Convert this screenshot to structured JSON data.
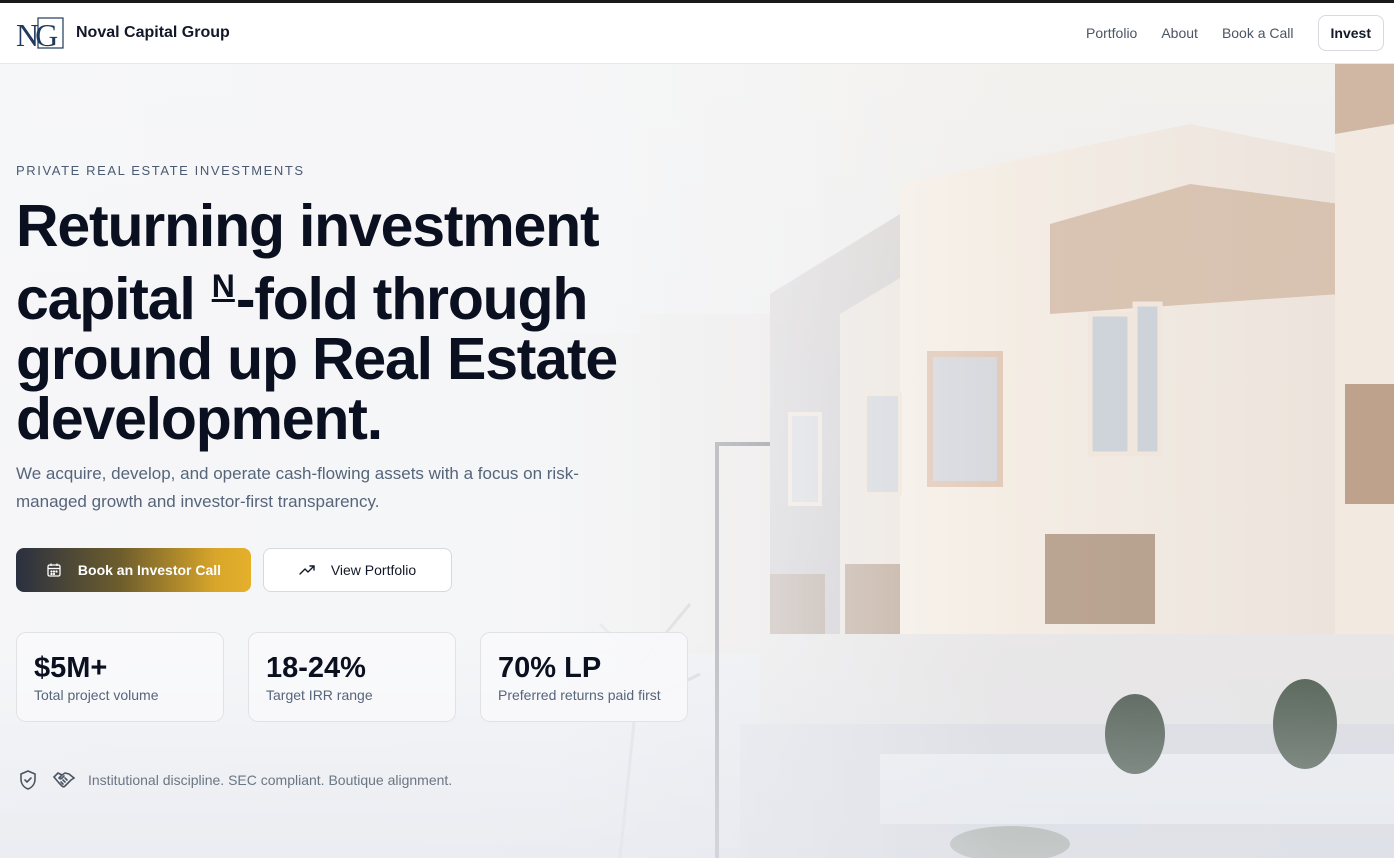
{
  "brand": {
    "logo_text": "NG",
    "name": "Noval Capital Group"
  },
  "nav": {
    "links": [
      "Portfolio",
      "About",
      "Book a Call"
    ],
    "cta": "Invest"
  },
  "hero": {
    "eyebrow": "PRIVATE REAL ESTATE INVESTMENTS",
    "headline": {
      "part1": "Returning investment capital ",
      "superscript": "N",
      "part2": "-fold through ground up Real Estate development."
    },
    "subheading": "We acquire, develop, and operate cash-flowing assets with a focus on risk-managed growth and investor-first transparency.",
    "primary_button": "Book an Investor Call",
    "secondary_button": "View Portfolio",
    "stats": [
      {
        "value": "$5M+",
        "label": "Total project volume"
      },
      {
        "value": "18-24%",
        "label": "Target IRR range"
      },
      {
        "value": "70% LP",
        "label": "Preferred returns paid first"
      }
    ],
    "trust_text": "Institutional discipline. SEC compliant. Boutique alignment."
  },
  "icons": {
    "primary_button": "calendar-icon",
    "secondary_button": "trending-up-icon",
    "trust": [
      "shield-check-icon",
      "handshake-icon"
    ]
  },
  "colors": {
    "text_dark": "#0b1020",
    "muted": "#56657a",
    "accent_gold": "#e5b02b",
    "accent_dark": "#2a3040",
    "logo_blue": "#1f3a5c"
  }
}
